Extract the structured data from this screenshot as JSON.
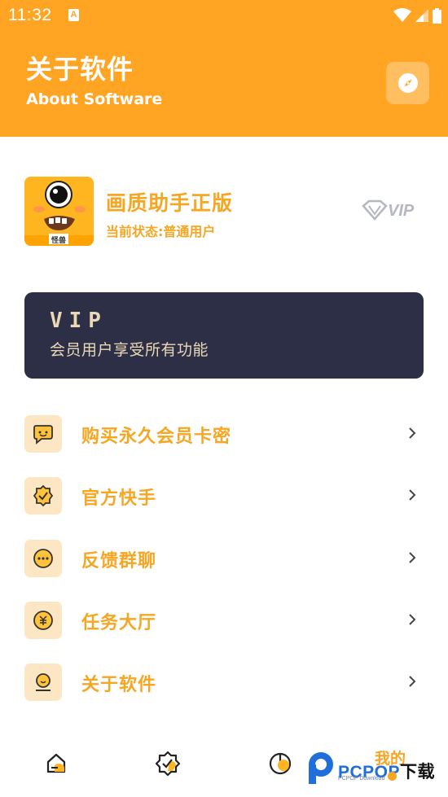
{
  "status_bar": {
    "time": "11:32",
    "notification_badge": "A"
  },
  "header": {
    "title": "关于软件",
    "subtitle": "About Software",
    "compass_icon": "compass-icon",
    "background_color": "#FFA523"
  },
  "app": {
    "name": "画质助手正版",
    "status": "当前状态:普通用户",
    "icon_label": "怪兽",
    "badge": "VIP"
  },
  "vip_card": {
    "title": "VIP",
    "subtitle": "会员用户享受所有功能",
    "background_color": "#2C2F45"
  },
  "menu": [
    {
      "label": "购买永久会员卡密",
      "icon": "chat-bubble-icon"
    },
    {
      "label": "官方快手",
      "icon": "verified-badge-icon"
    },
    {
      "label": "反馈群聊",
      "icon": "more-dots-icon"
    },
    {
      "label": "任务大厅",
      "icon": "coin-icon"
    },
    {
      "label": "关于软件",
      "icon": "user-profile-icon"
    }
  ],
  "bottom_nav": {
    "items": [
      {
        "icon": "home-icon"
      },
      {
        "icon": "badge-check-icon"
      },
      {
        "icon": "pie-chart-icon"
      },
      {
        "label": "我的"
      }
    ]
  },
  "watermark": {
    "brand": "PCPOP",
    "suffix": "下载",
    "small": "PCPOP Download"
  },
  "colors": {
    "accent": "#F5A623",
    "icon_bg": "#FDE6C4",
    "vip_text": "#EBD9B6"
  }
}
